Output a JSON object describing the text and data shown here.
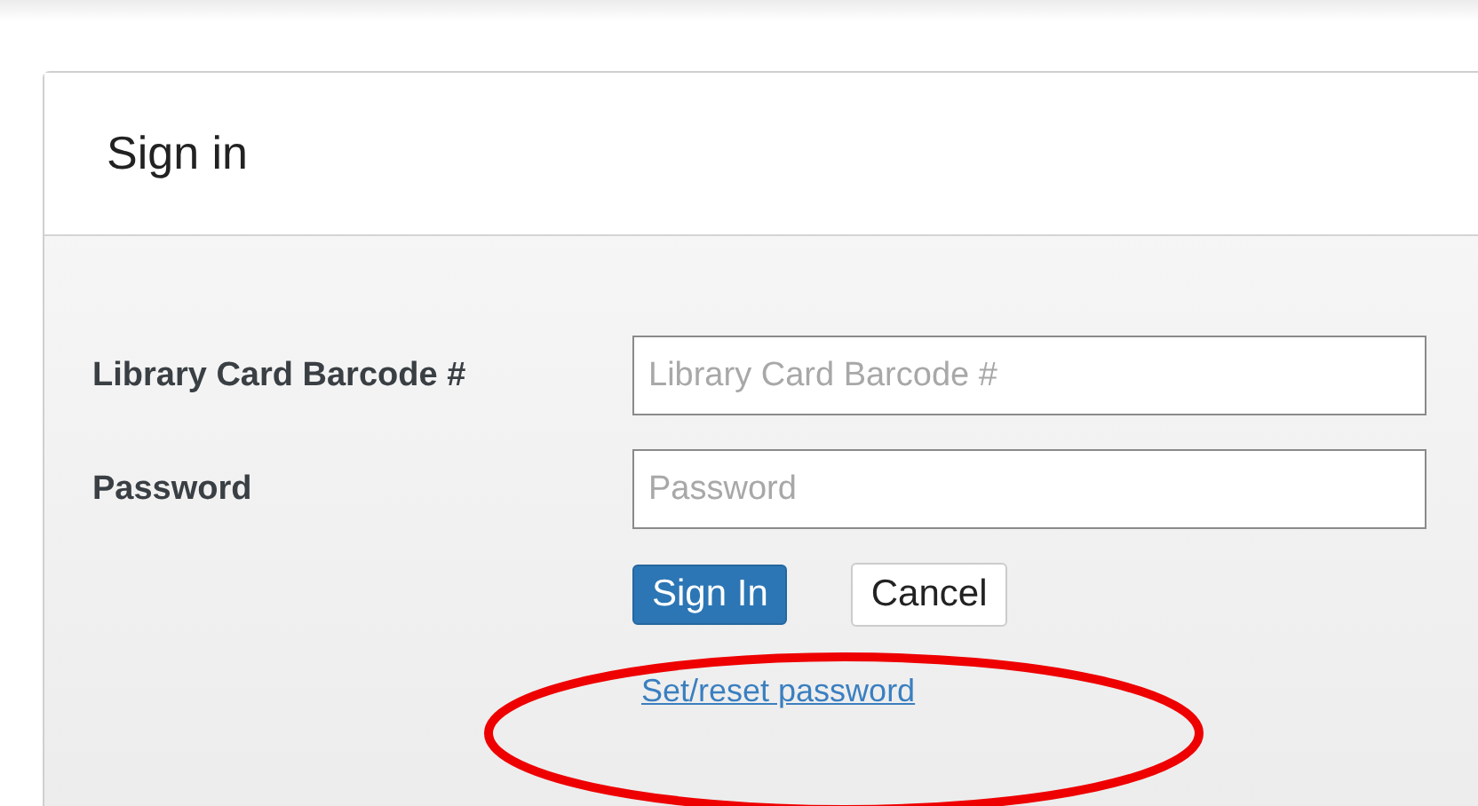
{
  "panel": {
    "title": "Sign in"
  },
  "fields": [
    {
      "label": "Library Card Barcode #",
      "placeholder": "Library Card Barcode #"
    },
    {
      "label": "Password",
      "placeholder": "Password"
    }
  ],
  "buttons": [
    {
      "label": "Sign In",
      "kind": "primary"
    },
    {
      "label": "Cancel",
      "kind": "default"
    }
  ],
  "link": "Set/reset password"
}
